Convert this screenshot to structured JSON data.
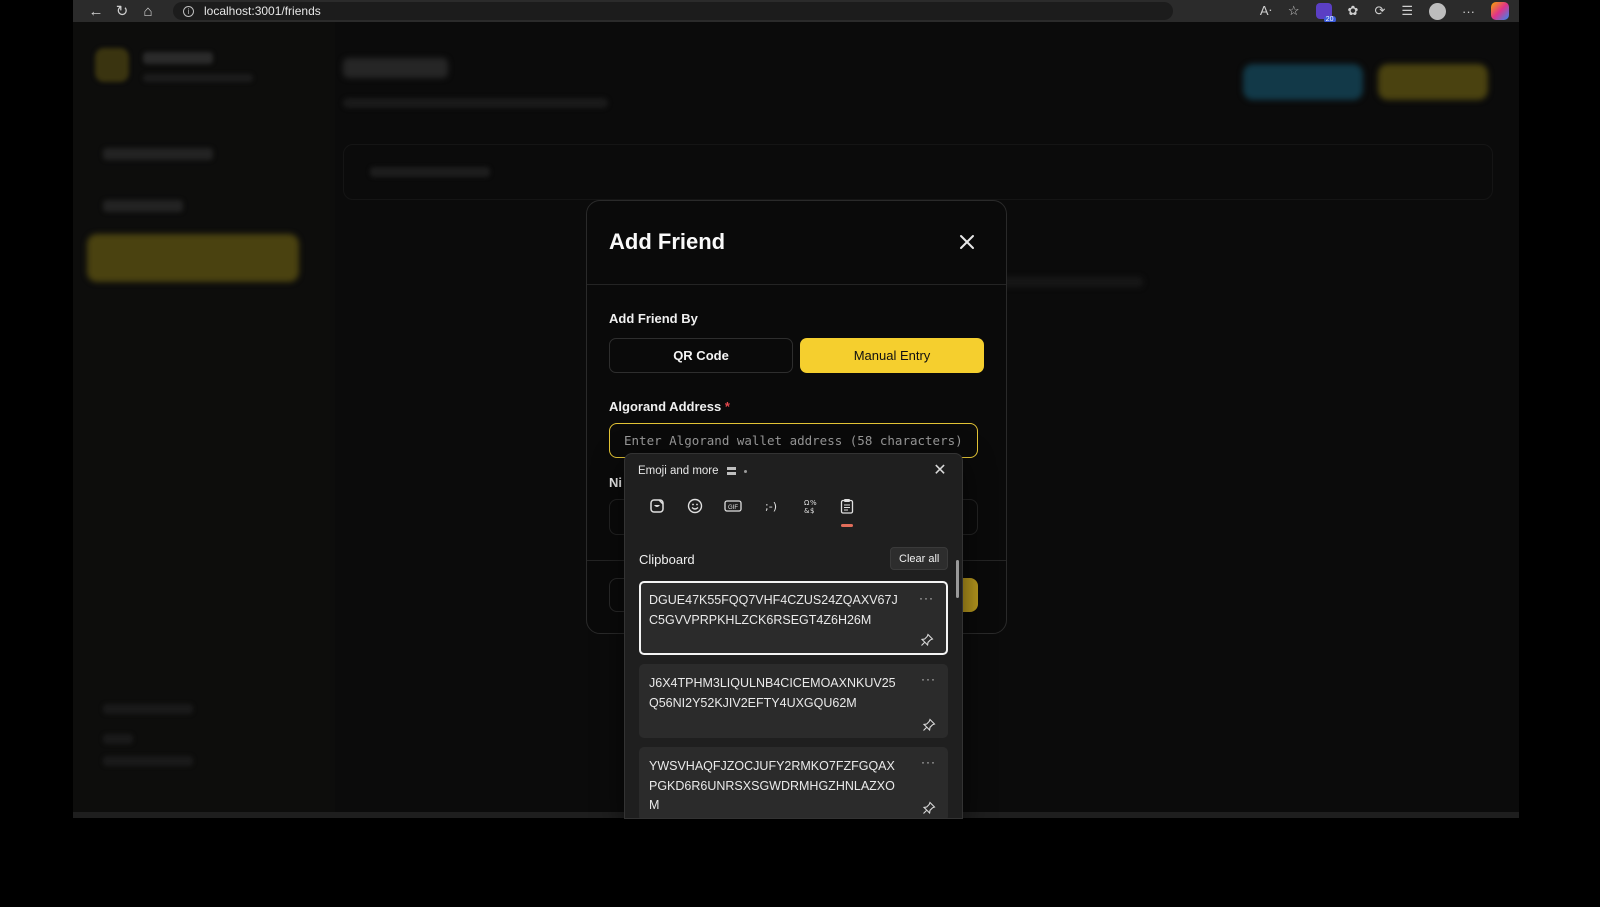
{
  "browser": {
    "url": "localhost:3001/friends",
    "extension_badge": "20"
  },
  "modal": {
    "title": "Add Friend",
    "add_by_label": "Add Friend By",
    "tabs": {
      "qr": "QR Code",
      "manual": "Manual Entry"
    },
    "address": {
      "label": "Algorand Address",
      "required_mark": "*",
      "placeholder": "Enter Algorand wallet address (58 characters)"
    },
    "nickname_label_partial": "Ni"
  },
  "clipboard_panel": {
    "title": "Emoji and more",
    "tab_icons": [
      "sticker-icon",
      "emoji-icon",
      "gif-icon",
      "kaomoji-icon",
      "symbols-icon",
      "clipboard-icon"
    ],
    "active_tab": "clipboard",
    "section_title": "Clipboard",
    "clear_all": "Clear all",
    "items": [
      {
        "text": "DGUE47K55FQQ7VHF4CZUS24ZQAXV67JC5GVVPRPKHLZCK6RSEGT4Z6H26M",
        "selected": true
      },
      {
        "text": "J6X4TPHM3LIQULNB4CICEMOAXNKUV25Q56NI2Y52KJIV2EFTY4UXGQU62M",
        "selected": false
      },
      {
        "text": "YWSVHAQFJZOCJUFY2RMKO7FZFGQAXPGKD6R6UNRSXSGWDRMHGZHNLAZXOM",
        "selected": false
      }
    ]
  },
  "colors": {
    "accent_yellow": "#f5cf2e",
    "input_focus_border": "#e2c335",
    "required_red": "#e5484d",
    "active_tab_indicator": "#e26d5a"
  }
}
